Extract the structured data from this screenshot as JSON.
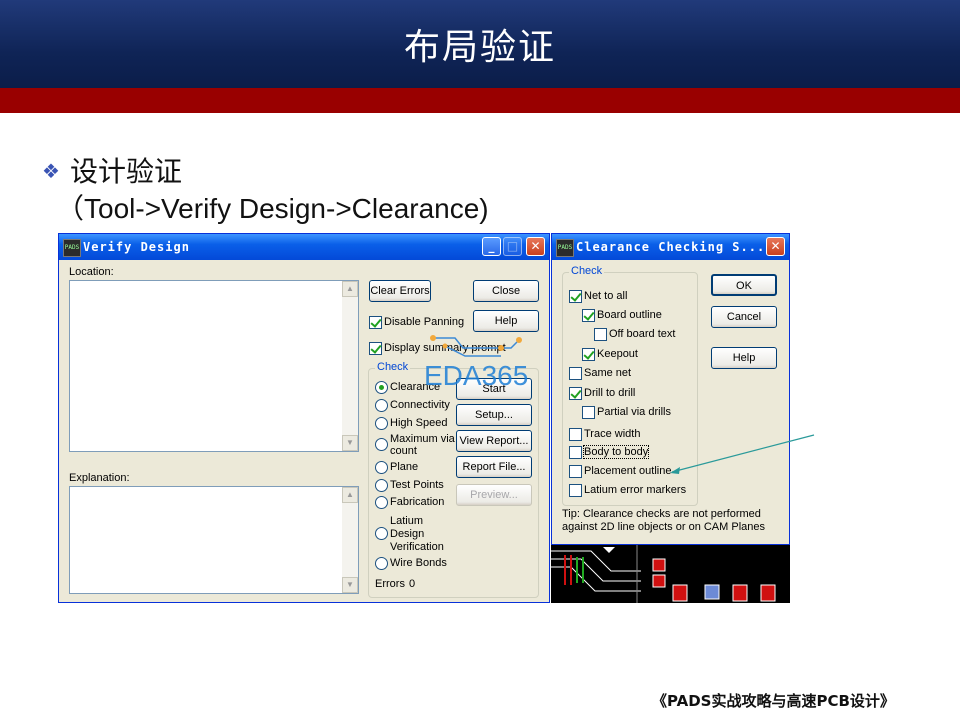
{
  "slide": {
    "title": "布局验证",
    "bullet_text": "设计验证",
    "bullet_symbol": "❖",
    "subline": "（Tool->Verify Design->Clearance)",
    "footer": "《PADS实战攻略与高速PCB设计》",
    "watermark": "EDA365"
  },
  "verify": {
    "title": "Verify Design",
    "app_icon": "PADS",
    "location_label": "Location:",
    "explanation_label": "Explanation:",
    "buttons": {
      "clear_errors": "Clear Errors",
      "close": "Close",
      "help": "Help",
      "start": "Start",
      "setup": "Setup...",
      "view_report": "View Report...",
      "report_file": "Report File...",
      "preview": "Preview..."
    },
    "options": {
      "disable_panning": "Disable Panning",
      "display_summary": "Display summary prompt"
    },
    "check_group": "Check",
    "checks": [
      "Clearance",
      "Connectivity",
      "High Speed",
      "Maximum via count",
      "Plane",
      "Test Points",
      "Fabrication",
      "Latium Design Verification",
      "Wire Bonds"
    ],
    "errors_label": "Errors",
    "errors_value": "0"
  },
  "clearance": {
    "title": "Clearance Checking S...",
    "app_icon": "PADS",
    "group": "Check",
    "items": {
      "net_to_all": "Net to all",
      "board_outline": "Board outline",
      "off_board_text": "Off board text",
      "keepout": "Keepout",
      "same_net": "Same net",
      "drill_to_drill": "Drill to drill",
      "partial_via_drills": "Partial via drills",
      "trace_width": "Trace width",
      "body_to_body": "Body to body",
      "placement_outline": "Placement outline",
      "latium_error_markers": "Latium error markers"
    },
    "buttons": {
      "ok": "OK",
      "cancel": "Cancel",
      "help": "Help"
    },
    "tip": "Tip: Clearance checks are not performed against 2D line objects or on CAM Planes"
  },
  "colors": {
    "header_blue": "#0f2456",
    "header_red": "#990000",
    "dialog_bg": "#ece9d8",
    "titlebar": "#0a5fe8",
    "watermark": "#1e7fd6",
    "callout_line": "#2a9a9a"
  }
}
